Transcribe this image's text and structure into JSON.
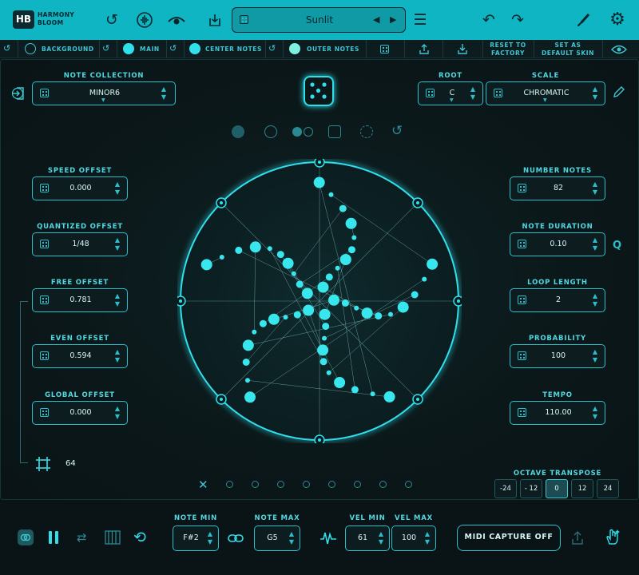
{
  "app": {
    "logo": "HB",
    "name_line1": "HARMONY",
    "name_line2": "BLOOM"
  },
  "preset": {
    "name": "Sunlit"
  },
  "row2": {
    "background": "BACKGROUND",
    "main": "MAIN",
    "center_notes": "CENTER NOTES",
    "outer_notes": "OUTER NOTES",
    "reset_line1": "RESET TO",
    "reset_line2": "FACTORY",
    "default_line1": "SET AS",
    "default_line2": "DEFAULT SKIN"
  },
  "colors": {
    "accent": "#10b5c4",
    "main_dot": "#2fe0ec",
    "center_dot": "#2fe0ec",
    "outer_dot": "#7ff0e0",
    "background": "#0a1416"
  },
  "note_collection": {
    "label": "NOTE COLLECTION",
    "value": "MINOR6"
  },
  "root": {
    "label": "ROOT",
    "value": "C"
  },
  "scale": {
    "label": "SCALE",
    "value": "CHROMATIC"
  },
  "left_params": [
    {
      "label": "SPEED OFFSET",
      "value": "0.000"
    },
    {
      "label": "QUANTIZED OFFSET",
      "value": "1/48"
    },
    {
      "label": "FREE OFFSET",
      "value": "0.781"
    },
    {
      "label": "EVEN OFFSET",
      "value": "0.594"
    },
    {
      "label": "GLOBAL OFFSET",
      "value": "0.000"
    }
  ],
  "right_params": [
    {
      "label": "NUMBER NOTES",
      "value": "82"
    },
    {
      "label": "NOTE DURATION",
      "value": "0.10"
    },
    {
      "label": "LOOP LENGTH",
      "value": "2"
    },
    {
      "label": "PROBABILITY",
      "value": "100"
    },
    {
      "label": "TEMPO",
      "value": "110.00"
    }
  ],
  "q_label": "Q",
  "grid_value": "64",
  "octave": {
    "label": "OCTAVE TRANSPOSE",
    "options": [
      "-24",
      "- 12",
      "0",
      "12",
      "24"
    ],
    "selected": "0"
  },
  "bottom": {
    "note_min_label": "NOTE MIN",
    "note_min": "F#2",
    "note_max_label": "NOTE MAX",
    "note_max": "G5",
    "vel_min_label": "VEL MIN",
    "vel_min": "61",
    "vel_max_label": "VEL MAX",
    "vel_max": "100",
    "midi_capture": "MIDI CAPTURE OFF"
  }
}
